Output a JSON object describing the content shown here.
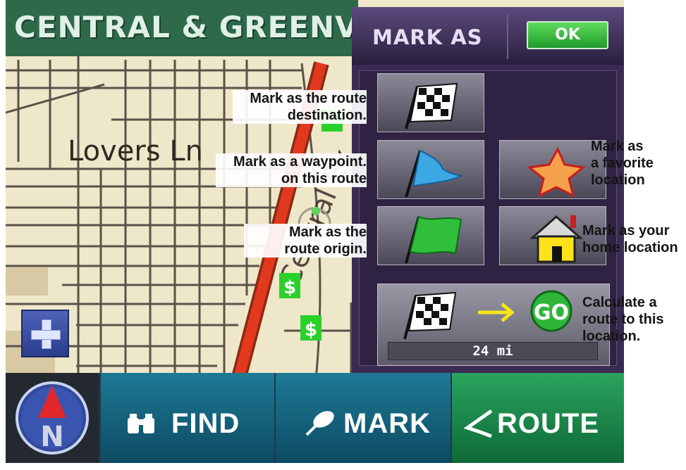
{
  "map": {
    "street_header": "CENTRAL & GREENVI",
    "street_label": "Lovers Ln",
    "road_label": "Central Ex",
    "poi_symbol": "$",
    "colors": {
      "background": "#efe7c9",
      "streets": "#5a5248",
      "highway": "#e2391e",
      "poi": "#2bd12b"
    }
  },
  "mark_panel": {
    "title": "MARK AS",
    "ok_label": "OK",
    "buttons": [
      {
        "id": "destination",
        "icon": "checkered-flag-icon"
      },
      {
        "id": "waypoint",
        "icon": "blue-flag-icon"
      },
      {
        "id": "favorite",
        "icon": "star-icon"
      },
      {
        "id": "origin",
        "icon": "green-flag-icon"
      },
      {
        "id": "home",
        "icon": "house-icon"
      }
    ],
    "go": {
      "label": "GO",
      "distance": "24 mi",
      "icons": [
        "checkered-flag-icon",
        "arrow-right-icon",
        "go-button-icon"
      ]
    }
  },
  "bottom_bar": {
    "compass_letter": "N",
    "tabs": [
      {
        "label": "FIND",
        "icon": "binoculars-icon"
      },
      {
        "label": "MARK",
        "icon": "pushpin-icon"
      },
      {
        "label": "ROUTE",
        "icon": "route-icon"
      }
    ]
  },
  "callouts": {
    "destination": [
      "Mark as the route",
      "destination."
    ],
    "waypoint": [
      "Mark as a waypoint.",
      "on this route"
    ],
    "origin": [
      "Mark as the",
      "route origin."
    ],
    "favorite": [
      "Mark as",
      "a favorite",
      "location"
    ],
    "home": [
      "Mark as your",
      "home location"
    ],
    "go": [
      "Calculate a",
      "route to this",
      "location."
    ]
  }
}
